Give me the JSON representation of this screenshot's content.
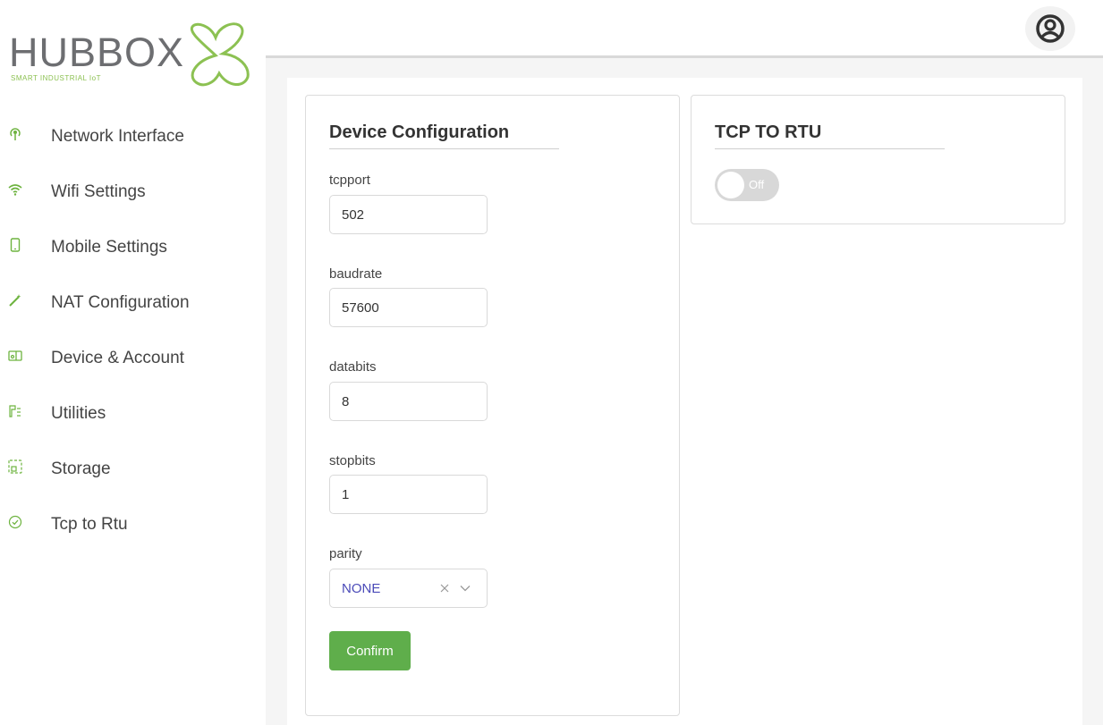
{
  "brand": {
    "name": "HUBBOX",
    "tagline": "SMART INDUSTRIAL IoT",
    "accent_color": "#6db33f"
  },
  "sidebar": {
    "items": [
      {
        "label": "Network Interface",
        "icon": "antenna-icon"
      },
      {
        "label": "Wifi Settings",
        "icon": "wifi-icon"
      },
      {
        "label": "Mobile Settings",
        "icon": "mobile-icon"
      },
      {
        "label": "NAT Configuration",
        "icon": "magic-wand-icon"
      },
      {
        "label": "Device & Account",
        "icon": "devices-icon"
      },
      {
        "label": "Utilities",
        "icon": "tools-icon"
      },
      {
        "label": "Storage",
        "icon": "storage-icon"
      },
      {
        "label": "Tcp to Rtu",
        "icon": "check-circle-icon"
      }
    ]
  },
  "header": {
    "avatar_icon": "user-avatar-icon"
  },
  "device_config": {
    "title": "Device Configuration",
    "tcpport": {
      "label": "tcpport",
      "value": "502"
    },
    "baudrate": {
      "label": "baudrate",
      "value": "57600"
    },
    "databits": {
      "label": "databits",
      "value": "8"
    },
    "stopbits": {
      "label": "stopbits",
      "value": "1"
    },
    "parity": {
      "label": "parity",
      "value": "NONE"
    },
    "confirm_label": "Confirm",
    "button_color": "#5fae4b"
  },
  "tcp_to_rtu": {
    "title": "TCP TO RTU",
    "toggle_text": "Off",
    "enabled": false
  }
}
